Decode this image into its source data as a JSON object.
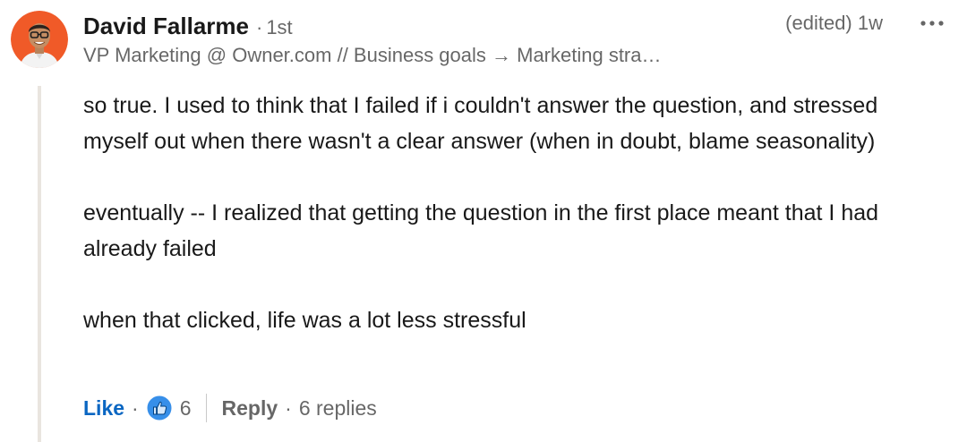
{
  "comment": {
    "author": {
      "name": "David Fallarme",
      "degree": "1st",
      "headline": "VP Marketing @ Owner.com // Business goals → Marketing stra…",
      "avatar_icon": "profile-photo"
    },
    "meta": "(edited) 1w",
    "more_icon": "ellipsis-icon",
    "body": {
      "paragraphs": [
        "so true. I used to think that I failed if i couldn't answer the question, and stressed myself out when there wasn't a clear answer (when in doubt, blame seasonality)",
        "eventually -- I realized that getting the question in the first place meant that I had already failed",
        "when that clicked, life was a lot less stressful"
      ]
    },
    "actions": {
      "like_label": "Like",
      "separator": "·",
      "reaction_icon": "like-reaction-icon",
      "reaction_count": "6",
      "reply_label": "Reply",
      "replies_label": "6 replies"
    }
  },
  "colors": {
    "accent": "#0a66c2",
    "avatar_bg": "#f05a28",
    "thread_line": "#e9e5df"
  }
}
